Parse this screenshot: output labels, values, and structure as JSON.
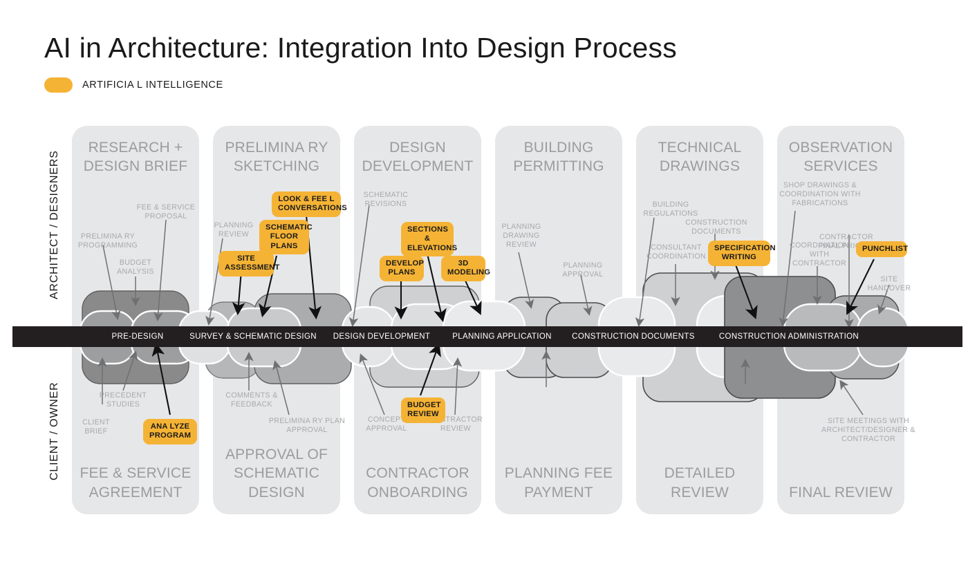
{
  "header": {
    "title": "AI in  Architecture: Integration Into Design Process",
    "legend_label": "ARTIFICIA L INTELLIGENCE",
    "legend_color": "#F5B335"
  },
  "roles": {
    "top": "ARCHITECT / DESIGNERS",
    "bottom": "CLIENT / OWNER"
  },
  "phases": [
    {
      "title": "RESEARCH +\nDESIGN BRIEF",
      "footer": "FEE &\nSERVICE\nAGREEMENT"
    },
    {
      "title": "PRELIMINA RY\nSKETCHING",
      "footer": "APPROVAL OF\nSCHEMATIC\nDESIGN"
    },
    {
      "title": "DESIGN\nDEVELOPMENT",
      "footer": "CONTRACTOR\nONBOARDING"
    },
    {
      "title": "BUILDING\nPERMITTING",
      "footer": "PLANNING FEE\nPAYMENT"
    },
    {
      "title": "TECHNICAL\nDRAWINGS",
      "footer": "DETAILED\nREVIEW"
    },
    {
      "title": "OBSERVATION\nSERVICES",
      "footer": "FINAL\nREVIEW"
    }
  ],
  "timeline": {
    "color": "#231F20",
    "segments": [
      "PRE-DESIGN",
      "SURVEY & SCHEMATIC DESIGN",
      "DESIGN DEVELOPMENT",
      "PLANNING APPLICATION",
      "CONSTRUCTION DOCUMENTS",
      "CONSTRUCTION ADMINISTRATION"
    ]
  },
  "annotations_top": [
    "PRELIMINA RY\nPROGRAMMING",
    "BUDGET\nANALYSIS",
    "FEE & SERVICE\nPROPOSAL",
    "PLANNING\nREVIEW",
    "SCHEMATIC\nREVISIONS",
    "PLANNING\nDRAWING\nREVIEW",
    "PLANNING\nAPPROVAL",
    "BUILDING\nREGULATIONS",
    "CONSTRUCTION\nDOCUMENTS",
    "CONSULTANT\nCOORDINATION",
    "SHOP DRAWINGS &\nCOORDINATION WITH\nFABRICATIONS",
    "CONTRACTOR\nFINAL PRICING",
    "COORDINATION\nWITH\nCONTRACTOR",
    "SITE\nHANDOVER"
  ],
  "annotations_bottom": [
    "PRECEDENT\nSTUDIES",
    "CLIENT\nBRIEF",
    "COMMENTS &\nFEEDBACK",
    "PRELIMINA RY PLAN\nAPPROVAL",
    "CONCEPT\nAPPROVAL",
    "CONTRACTOR\nREVIEW",
    "SITE MEETINGS WITH\nARCHITECT/DESIGNER &\nCONTRACTOR"
  ],
  "ai_callouts": [
    "ANA LYZE\nPROGRAM",
    "SITE\nASSESSMENT",
    "SCHEMATIC\nFLOOR\nPLANS",
    "LOOK & FEE L\nCONVERSATIONS",
    "DEVELOP\nPLANS",
    "SECTIONS &\nELEVATIONS",
    "3D\nMODELING",
    "BUDGET\nREVIEW",
    "SPECIFICATION\nWRITING",
    "PUNCHLIST"
  ],
  "palette": {
    "column_bg": "#E6E7E8",
    "column_text": "#9B9C9E",
    "annotation_text": "#A7A9AC",
    "blob_dark": "#8A8A8A",
    "blob_mid": "#ABACAE",
    "blob_light": "#C9CACC",
    "blob_lighter": "#DCDDDE",
    "blob_palest": "#E9EAEB"
  }
}
